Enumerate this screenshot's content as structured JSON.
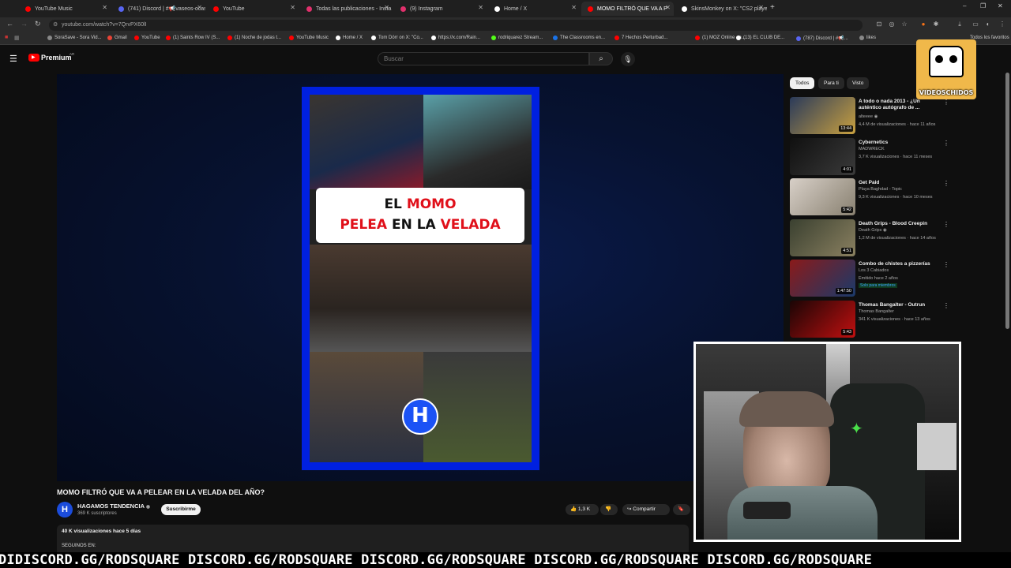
{
  "browser": {
    "tabs": [
      {
        "label": "YouTube Music",
        "color": "#ff0000"
      },
      {
        "label": "(741) Discord | #📢vaseos-ocas",
        "color": "#5865f2"
      },
      {
        "label": "YouTube",
        "color": "#ff0000"
      },
      {
        "label": "Todas las publicaciones - Insta",
        "color": "#e1306c"
      },
      {
        "label": "(9) Instagram",
        "color": "#e1306c"
      },
      {
        "label": "Home / X",
        "color": "#ffffff"
      },
      {
        "label": "MOMO FILTRÓ QUE VA A P",
        "color": "#ff0000"
      },
      {
        "label": "SkinsMonkey on X: \"CS2 playe",
        "color": "#ffffff"
      }
    ],
    "new_tab": "+",
    "window_controls": [
      "–",
      "❐",
      "✕"
    ],
    "url": "youtube.com/watch?v=7QrvPX60lI",
    "bookmarks": [
      {
        "label": "SoraSave - Sora Vid...",
        "color": "#888888"
      },
      {
        "label": "Gmail",
        "color": "#ea4335"
      },
      {
        "label": "YouTube",
        "color": "#ff0000"
      },
      {
        "label": "(1) Saints Row IV (S...",
        "color": "#ff0000"
      },
      {
        "label": "(1) Noche de jodas t...",
        "color": "#ff0000"
      },
      {
        "label": "YouTube Music",
        "color": "#ff0000"
      },
      {
        "label": "Home / X",
        "color": "#ffffff"
      },
      {
        "label": "Tom Dórr on X: \"Co...",
        "color": "#ffffff"
      },
      {
        "label": "https://x.com/Rain...",
        "color": "#ffffff"
      },
      {
        "label": "rodriquarez Stream...",
        "color": "#53fc18"
      },
      {
        "label": "The Classrooms en...",
        "color": "#1a73e8"
      },
      {
        "label": "7 Hechos Perturbad...",
        "color": "#ff0000"
      },
      {
        "label": "(1) MOZ Online on...",
        "color": "#ff0000"
      },
      {
        "label": "(13) EL CLUB DE...",
        "color": "#ffffff"
      },
      {
        "label": "(787) Discord | #📢...",
        "color": "#5865f2"
      },
      {
        "label": "likes",
        "color": "#888888"
      }
    ],
    "all_bookmarks": "Todos los favoritos"
  },
  "youtube": {
    "logo_text": "Premium",
    "logo_region": "AR",
    "search_placeholder": "Buscar",
    "video": {
      "title": "MOMO FILTRÓ QUE VA A PELEAR EN LA VELADA DEL AÑO?",
      "thumbnail_line1_a": "EL ",
      "thumbnail_line1_b": "MOMO",
      "thumbnail_line2_a": "PELEA",
      "thumbnail_line2_b": " EN LA ",
      "thumbnail_line2_c": "VELADA",
      "badge": "H"
    },
    "channel": {
      "name": "HAGAMOS TENDENCIA",
      "verified": "◉",
      "subs": "369 K suscriptores",
      "subscribe": "Suscribirme",
      "avatar": "H"
    },
    "actions": {
      "likes": "1,3 K",
      "share": "Compartir"
    },
    "description": {
      "views": "40 K visualizaciones  hace 5 días",
      "follow": "SEGUINOS EN:"
    },
    "chips": [
      {
        "label": "Todos",
        "selected": true
      },
      {
        "label": "Para ti",
        "selected": false
      },
      {
        "label": "Visto",
        "selected": false
      }
    ],
    "recommendations": [
      {
        "title": "A todo o nada 2013 - ¿Un auténtico autógrafo de ...",
        "channel": "alteeee ◉",
        "meta": "4,4 M de visualizaciones · hace 11 años",
        "duration": "13:44",
        "c1": "#2a3a5a",
        "c2": "#c8a040"
      },
      {
        "title": "Cybernetics",
        "channel": "MADWRECK",
        "meta": "3,7 K visualizaciones · hace 11 meses",
        "duration": "4:01",
        "c1": "#101010",
        "c2": "#3a3a3a"
      },
      {
        "title": "Get Paid",
        "channel": "Playa Baghdad - Topic",
        "meta": "9,3 K visualizaciones · hace 10 meses",
        "duration": "5:42",
        "c1": "#d8d0c8",
        "c2": "#888070"
      },
      {
        "title": "Death Grips - Blood Creepin",
        "channel": "Death Grips ◉",
        "meta": "1,2 M de visualizaciones · hace 14 años",
        "duration": "4:51",
        "c1": "#3a4030",
        "c2": "#8a8060"
      },
      {
        "title": "Combo de chistes a pizzerías",
        "channel": "Los 3 Cabiados",
        "meta": "Emitido hace 2 años",
        "duration": "1:47:50",
        "c1": "#8a1a1a",
        "c2": "#1a3a6a",
        "members": "Solo para miembros"
      },
      {
        "title": "Thomas Bangalter - Outrun",
        "channel": "Thomas Bangalter",
        "meta": "341 K visualizaciones · hace 13 años",
        "duration": "5:43",
        "c1": "#1a0505",
        "c2": "#c01010"
      }
    ]
  },
  "overlay": {
    "logo": "VIDEOSCHIDOS",
    "ticker": "DIDISCORD.GG/RODSQUARE DISCORD.GG/RODSQUARE DISCORD.GG/RODSQUARE DISCORD.GG/RODSQUARE DISCORD.GG/RODSQUARE"
  }
}
